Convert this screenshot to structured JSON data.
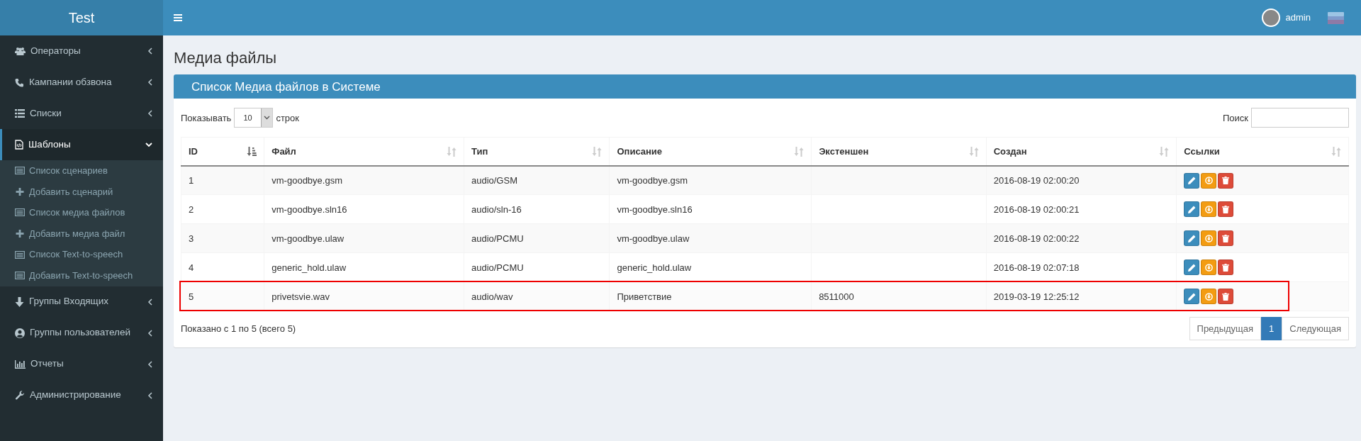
{
  "brand": "Test",
  "topbar": {
    "user": "admin"
  },
  "sidebar": {
    "items": [
      {
        "label": "Операторы",
        "expanded": false,
        "selected": false
      },
      {
        "label": "Кампании обзвона",
        "expanded": false,
        "selected": false
      },
      {
        "label": "Списки",
        "expanded": false,
        "selected": false
      },
      {
        "label": "Шаблоны",
        "expanded": true,
        "selected": true,
        "children": [
          {
            "label": "Список сценариев",
            "kind": "list",
            "selected": false
          },
          {
            "label": "Добавить сценарий",
            "kind": "add",
            "selected": false
          },
          {
            "label": "Список медиа файлов",
            "kind": "list",
            "selected": false
          },
          {
            "label": "Добавить медиа файл",
            "kind": "add",
            "selected": false
          },
          {
            "label": "Список Text-to-speech",
            "kind": "list",
            "selected": false
          },
          {
            "label": "Добавить Text-to-speech",
            "kind": "list",
            "selected": false
          }
        ]
      },
      {
        "label": "Группы Входящих",
        "expanded": false,
        "selected": false
      },
      {
        "label": "Группы пользователей",
        "expanded": false,
        "selected": false
      },
      {
        "label": "Отчеты",
        "expanded": false,
        "selected": false
      },
      {
        "label": "Администрирование",
        "expanded": false,
        "selected": false
      }
    ]
  },
  "page_title": "Медиа файлы",
  "box": {
    "title": "Список Медиа файлов в Системе",
    "length": {
      "label": "Показывать",
      "value": "10",
      "suffix": "строк"
    },
    "search": {
      "label": "Поиск"
    },
    "table": {
      "columns": [
        {
          "label": "ID",
          "sorted": true
        },
        {
          "label": "Файл",
          "sorted": false
        },
        {
          "label": "Тип",
          "sorted": false
        },
        {
          "label": "Описание",
          "sorted": false
        },
        {
          "label": "Экстеншен",
          "sorted": false
        },
        {
          "label": "Создан",
          "sorted": false
        },
        {
          "label": "Ссылки",
          "sorted": false
        }
      ],
      "rows": [
        {
          "cells": [
            "1",
            "vm-goodbye.gsm",
            "audio/GSM",
            "vm-goodbye.gsm",
            "",
            "2016-08-19 02:00:20"
          ],
          "highlighted": false
        },
        {
          "cells": [
            "2",
            "vm-goodbye.sln16",
            "audio/sln-16",
            "vm-goodbye.sln16",
            "",
            "2016-08-19 02:00:21"
          ],
          "highlighted": false
        },
        {
          "cells": [
            "3",
            "vm-goodbye.ulaw",
            "audio/PCMU",
            "vm-goodbye.ulaw",
            "",
            "2016-08-19 02:00:22"
          ],
          "highlighted": false
        },
        {
          "cells": [
            "4",
            "generic_hold.ulaw",
            "audio/PCMU",
            "generic_hold.ulaw",
            "",
            "2016-08-19 02:07:18"
          ],
          "highlighted": false
        },
        {
          "cells": [
            "5",
            "privetsvie.wav",
            "audio/wav",
            "Приветствие",
            "8511000",
            "2019-03-19 12:25:12"
          ],
          "highlighted": true
        }
      ]
    },
    "info": "Показано с 1 по 5 (всего 5)",
    "pagination": [
      {
        "label": "Предыдущая",
        "selected": false
      },
      {
        "label": "1",
        "selected": true
      },
      {
        "label": "Следующая",
        "selected": false
      }
    ]
  }
}
